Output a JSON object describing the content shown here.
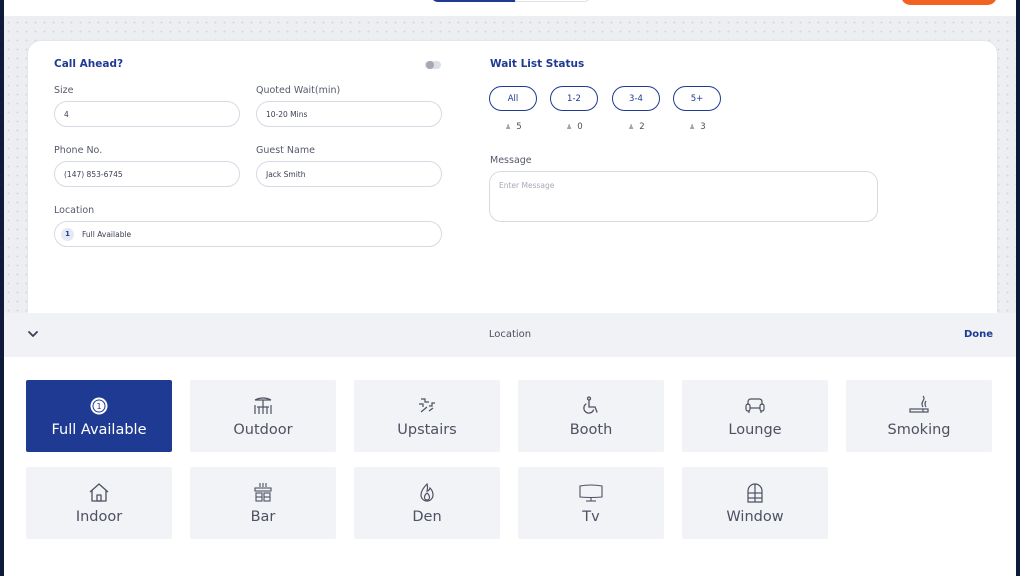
{
  "colors": {
    "primary": "#1f3a93",
    "accent": "#f26322",
    "tile_bg": "#f2f3f7"
  },
  "form": {
    "call_ahead_label": "Call Ahead?",
    "call_ahead_enabled": false,
    "size_label": "Size",
    "size_value": "4",
    "quoted_wait_label": "Quoted Wait(min)",
    "quoted_wait_value": "10-20 Mins",
    "phone_label": "Phone No.",
    "phone_value": "(147) 853-6745",
    "guest_name_label": "Guest Name",
    "guest_name_value": "Jack Smith",
    "location_label": "Location",
    "location_count": "1",
    "location_value": "Full Available"
  },
  "wait_list": {
    "title": "Wait List Status",
    "filters": [
      {
        "label": "All",
        "count": "5",
        "icon": "person-icon"
      },
      {
        "label": "1-2",
        "count": "0",
        "icon": "person-icon"
      },
      {
        "label": "3-4",
        "count": "2",
        "icon": "person-icon"
      },
      {
        "label": "5+",
        "count": "3",
        "icon": "person-icon"
      }
    ],
    "selected_filter": "All",
    "message_label": "Message",
    "message_placeholder": "Enter Message"
  },
  "location_panel": {
    "title": "Location",
    "done_label": "Done",
    "collapse_icon": "chevron-down-icon",
    "selected": "Full Available",
    "options": [
      {
        "label": "Full Available",
        "icon": "count-badge-icon",
        "badge": "1"
      },
      {
        "label": "Outdoor",
        "icon": "outdoor-table-icon"
      },
      {
        "label": "Upstairs",
        "icon": "stairs-icon"
      },
      {
        "label": "Booth",
        "icon": "wheelchair-icon"
      },
      {
        "label": "Lounge",
        "icon": "sofa-icon"
      },
      {
        "label": "Smoking",
        "icon": "cigarette-icon"
      },
      {
        "label": "Indoor",
        "icon": "house-icon"
      },
      {
        "label": "Bar",
        "icon": "bar-counter-icon"
      },
      {
        "label": "Den",
        "icon": "flame-icon"
      },
      {
        "label": "Tv",
        "icon": "tv-icon"
      },
      {
        "label": "Window",
        "icon": "window-icon"
      }
    ]
  }
}
